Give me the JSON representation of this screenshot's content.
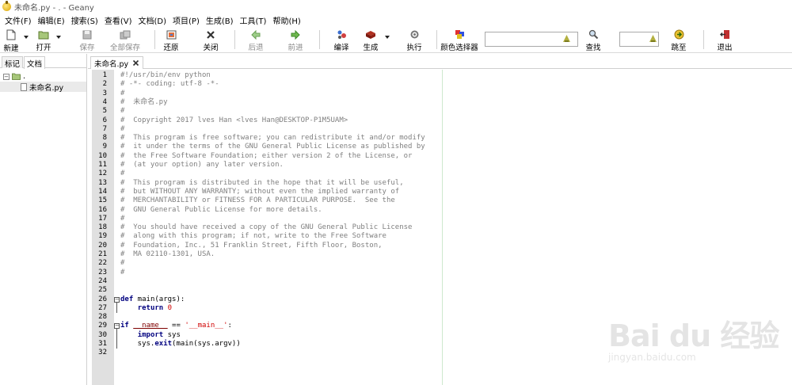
{
  "window": {
    "title": "未命名.py - . - Geany"
  },
  "menu": [
    "文件(F)",
    "编辑(E)",
    "搜索(S)",
    "查看(V)",
    "文档(D)",
    "项目(P)",
    "生成(B)",
    "工具(T)",
    "帮助(H)"
  ],
  "toolbar": {
    "new": "新建",
    "open": "打开",
    "save": "保存",
    "save_all": "全部保存",
    "revert": "还原",
    "close": "关闭",
    "back": "后退",
    "forward": "前进",
    "compile": "编译",
    "build": "生成",
    "execute": "执行",
    "color_picker": "颜色选择器",
    "search_value": "",
    "find": "查找",
    "goto_value": "",
    "goto": "跳至",
    "quit": "退出"
  },
  "sidebar": {
    "tabs": [
      "标记",
      "文档"
    ],
    "active_tab": "文档",
    "tree_root": ".",
    "tree_file": "未命名.py"
  },
  "editor": {
    "tab_label": "未命名.py",
    "lines": [
      "#!/usr/bin/env python",
      "# -*- coding: utf-8 -*-",
      "#",
      "#  未命名.py",
      "#",
      "#  Copyright 2017 lves Han <lves Han@DESKTOP-P1M5UAM>",
      "#",
      "#  This program is free software; you can redistribute it and/or modify",
      "#  it under the terms of the GNU General Public License as published by",
      "#  the Free Software Foundation; either version 2 of the License, or",
      "#  (at your option) any later version.",
      "#",
      "#  This program is distributed in the hope that it will be useful,",
      "#  but WITHOUT ANY WARRANTY; without even the implied warranty of",
      "#  MERCHANTABILITY or FITNESS FOR A PARTICULAR PURPOSE.  See the",
      "#  GNU General Public License for more details.",
      "#",
      "#  You should have received a copy of the GNU General Public License",
      "#  along with this program; if not, write to the Free Software",
      "#  Foundation, Inc., 51 Franklin Street, Fifth Floor, Boston,",
      "#  MA 02110-1301, USA.",
      "#",
      "#",
      "",
      "",
      "def main(args):",
      "    return 0",
      "",
      "if __name__ == '__main__':",
      "    import sys",
      "    sys.exit(main(sys.argv))",
      ""
    ]
  },
  "watermark": {
    "brand": "Bai du 经验",
    "sub": "jingyan.baidu.com"
  },
  "colors": {
    "comment": "#808080",
    "keyword": "#00007f",
    "number": "#d00000",
    "gutter": "#e0e0e0"
  }
}
